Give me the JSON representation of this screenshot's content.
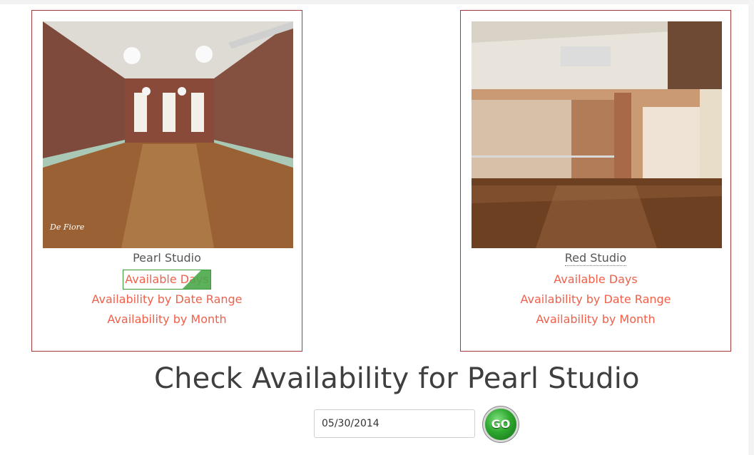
{
  "studios": [
    {
      "name": "Pearl Studio",
      "watermark": "De Fiore",
      "links": [
        "Available Days",
        "Availability by Date Range",
        "Availability by Month"
      ]
    },
    {
      "name": "Red Studio",
      "links": [
        "Available Days",
        "Availability by Date Range",
        "Availability by Month"
      ]
    }
  ],
  "check": {
    "heading": "Check Availability for Pearl Studio",
    "date_value": "05/30/2014",
    "go_label": "GO"
  },
  "colors": {
    "card_border": "#a33a3a",
    "link": "#f0604a",
    "go_button": "#2fa82f"
  }
}
